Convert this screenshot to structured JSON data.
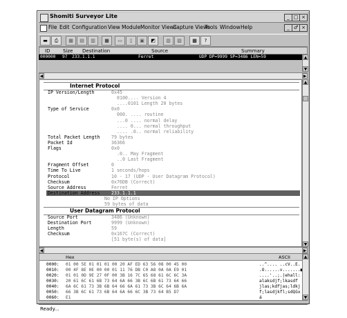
{
  "title": "Shomiti Surveyor Lite",
  "window_buttons": [
    "_",
    "□",
    "×"
  ],
  "mdi_buttons": [
    "_",
    "♂",
    "×"
  ],
  "menu": [
    "File",
    "Edit",
    "Configuration",
    "View",
    "Module",
    "Monitor Views",
    "Capture Views",
    "Tools",
    "Window",
    "Help"
  ],
  "toolbar_icons": [
    "save-icon",
    "print-icon",
    "grid-icon",
    "dual-grid-icon",
    "list-icon",
    "stop-icon",
    "open-icon",
    "page-icon",
    "filter-icon",
    "capture-icon",
    "bars-icon",
    "chart-icon",
    "settings-icon",
    "help-icon"
  ],
  "list": {
    "headers": [
      "ID",
      "Size",
      "Destination",
      "Source",
      "Summary"
    ],
    "row": {
      "id": "000000",
      "size": "97",
      "dest": "233.1.1.1",
      "source": "Ferret",
      "summary": "UDP DP=9999 SP=3486 LEN=59"
    }
  },
  "detail": {
    "ip_header": "Internet Protocol",
    "ip_fields": [
      {
        "label": "IP Version/Length",
        "value": "0x45"
      },
      {
        "label": "",
        "value": "0100.... Version 4"
      },
      {
        "label": "",
        "value": "....0101 Length 20 bytes"
      },
      {
        "label": "Type of Service",
        "value": "0x0"
      },
      {
        "label": "",
        "value": "000. .... routine"
      },
      {
        "label": "",
        "value": "...0 .... normal delay"
      },
      {
        "label": "",
        "value": ".... 0... normal throughput"
      },
      {
        "label": "",
        "value": ".... .0.. normal reliability"
      },
      {
        "label": "Total Packet Length",
        "value": "79 bytes"
      },
      {
        "label": "Packet Id",
        "value": "36366"
      },
      {
        "label": "Flags",
        "value": "0x0"
      },
      {
        "label": "",
        "value": ".0.. May Fragment"
      },
      {
        "label": "",
        "value": "..0 Last Fragment"
      },
      {
        "label": "Fragment Offset",
        "value": "0"
      },
      {
        "label": "Time To Live",
        "value": "1 seconds/hops"
      },
      {
        "label": "Protocol",
        "value": "10 - 17 (UDP - User Datagram Protocol)"
      },
      {
        "label": "Checksum",
        "value": "0x76DB (Correct)"
      },
      {
        "label": "Source Address",
        "value": "Ferret"
      },
      {
        "label": "Destination Address",
        "value": "233.1.1.1"
      },
      {
        "label": "",
        "value": "No IP Options"
      },
      {
        "label": "",
        "value": "59 bytes of data"
      }
    ],
    "udp_header": "User Datagram Protocol",
    "udp_fields": [
      {
        "label": "Source Port",
        "value": "3486 (Unknown)"
      },
      {
        "label": "Destination Port",
        "value": "9999 (Unknown)"
      },
      {
        "label": "Length",
        "value": "59"
      },
      {
        "label": "Checksum",
        "value": "0x167C (Correct)"
      },
      {
        "label": "",
        "value": "[51 byte(s) of data]"
      }
    ]
  },
  "hex": {
    "title": "Hex",
    "ascii_title": "ASCII",
    "rows": [
      {
        "off": "0000:",
        "bytes": "01 00 5E 01 01 01 00 20 AF ED 63 56 08 00 45 00",
        "ascii": "..^....  ..cV..E."
      },
      {
        "off": "0010:",
        "bytes": "00 4F 8E 0E 00 00 01 11 76 DB C0 A8 0A 0A E9 01",
        "ascii": ".O......v.......■"
      },
      {
        "off": "0020:",
        "bytes": "01 01 0D 9E 27 0F 00 3B 16 7C 65 68 61 6C 6C 3A",
        "ascii": "....'..;.|ehall:"
      },
      {
        "off": "0030:",
        "bytes": "20 61 6C 61 6B 73 64 6A 66 3B 6C 6B 61 73 64 66",
        "ascii": " alaksdjf;lkasdf"
      },
      {
        "off": "0040:",
        "bytes": "6A 6C 61 73 3B 6B 64 66 6A 61 73 3B 6C 64 6B 6A",
        "ascii": "jlas;kdfjas;ldkj"
      },
      {
        "off": "0050:",
        "bytes": "66 3B 6C 61 73 6B 64 6A 66 6C 3B 73 64 B5 D7",
        "ascii": "f;lasdjkfl;sdQûx"
      },
      {
        "off": "0060:",
        "bytes": "E1",
        "ascii": "á"
      }
    ]
  },
  "status": "Ready..."
}
